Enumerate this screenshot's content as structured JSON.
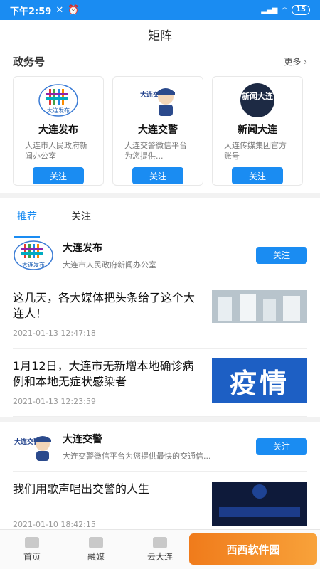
{
  "statusbar": {
    "time": "下午2:59",
    "battery": "15"
  },
  "header": {
    "title": "矩阵"
  },
  "gov_section": {
    "title": "政务号",
    "more": "更多",
    "cards": [
      {
        "name": "大连发布",
        "desc": "大连市人民政府新闻办公室",
        "follow": "关注"
      },
      {
        "name": "大连交警",
        "desc": "大连交警微信平台为您提供...",
        "follow": "关注"
      },
      {
        "name": "新闻大连",
        "desc": "大连传媒集团官方账号",
        "follow": "关注"
      }
    ]
  },
  "tabs": [
    {
      "label": "推荐"
    },
    {
      "label": "关注"
    }
  ],
  "feed": {
    "account1": {
      "name": "大连发布",
      "desc": "大连市人民政府新闻办公室",
      "follow": "关注"
    },
    "articles1": [
      {
        "title": "这几天，各大媒体把头条给了这个大连人！",
        "time": "2021-01-13 12:47:18"
      },
      {
        "title": "1月12日，大连市无新增本地确诊病例和本地无症状感染者",
        "time": "2021-01-13 12:23:59",
        "thumb_text": "疫情"
      }
    ],
    "account2": {
      "name": "大连交警",
      "desc": "大连交警微信平台为您提供最快的交通信...",
      "follow": "关注"
    },
    "articles2": [
      {
        "title": "我们用歌声唱出交警的人生",
        "time": "2021-01-10 18:42:15"
      }
    ]
  },
  "bottom_nav": [
    {
      "label": "首页"
    },
    {
      "label": "融媒"
    },
    {
      "label": "云大连"
    }
  ],
  "watermark": "西西软件园",
  "logo_text": {
    "xwdl": "新闻大连",
    "djjj": "大连交警",
    "dlfb": "大连发布"
  },
  "colors": {
    "accent": "#1a8cf2"
  }
}
